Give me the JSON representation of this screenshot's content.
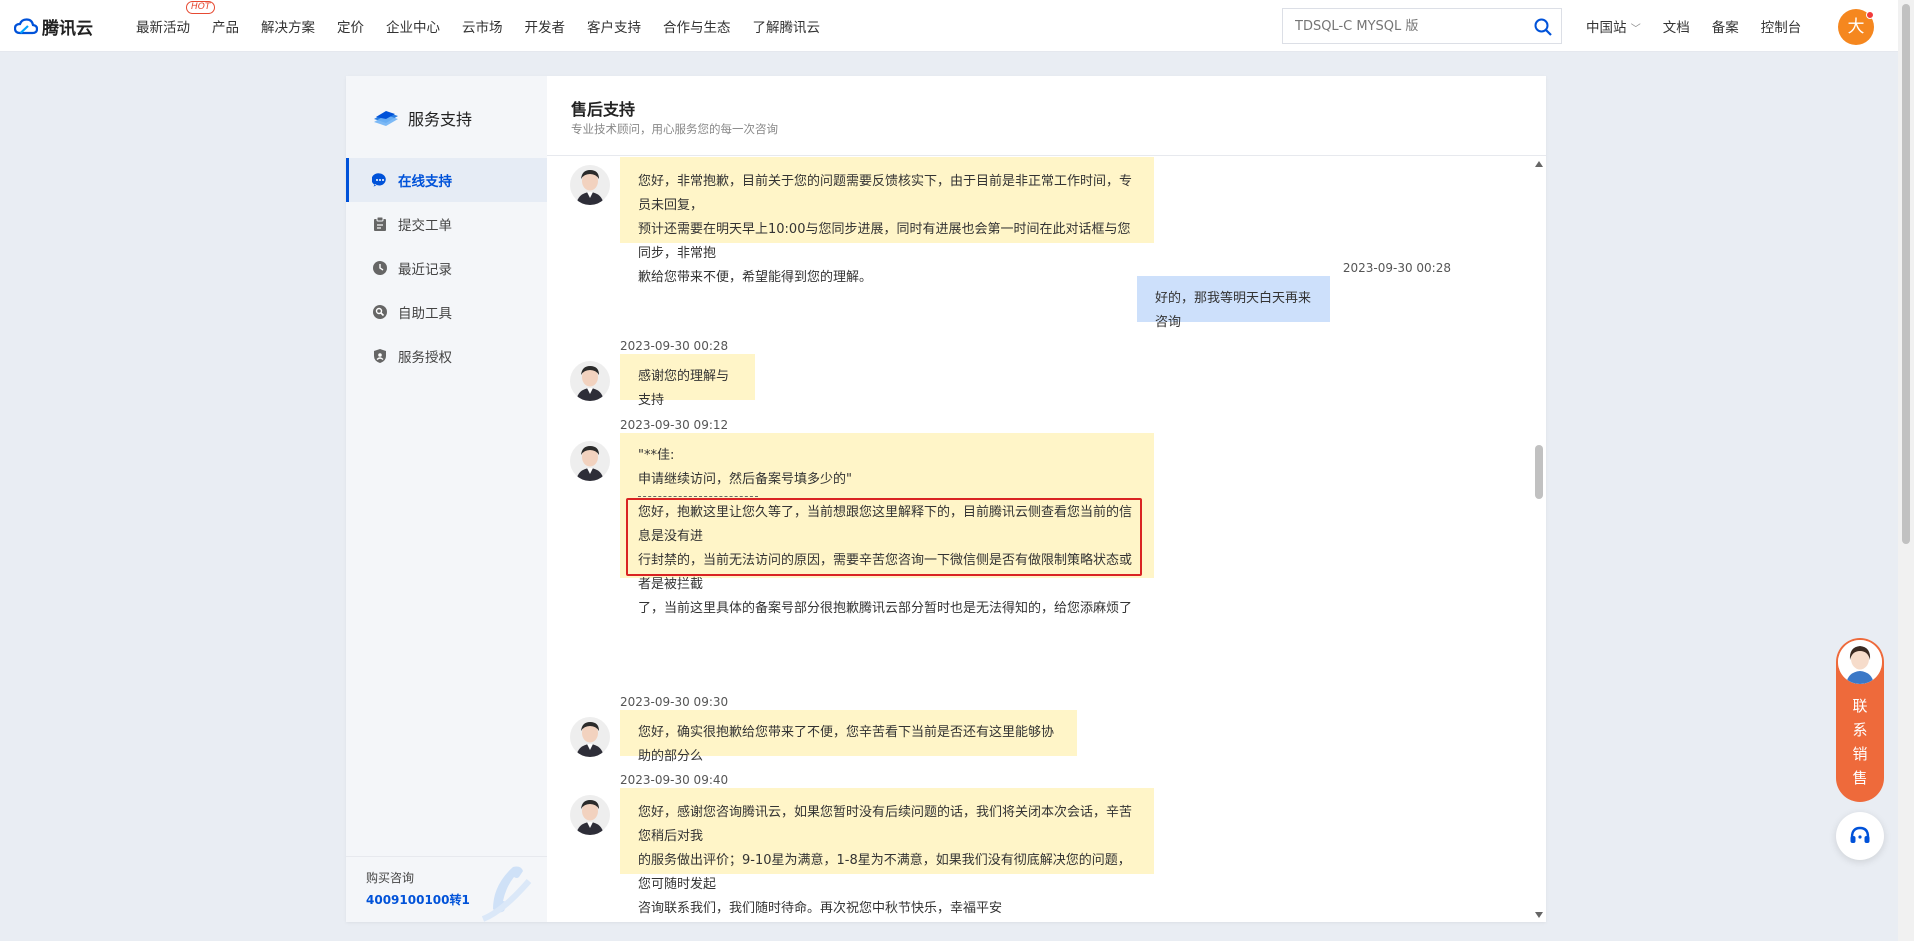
{
  "brand": {
    "name": "腾讯云"
  },
  "nav": {
    "items": [
      "最新活动",
      "产品",
      "解决方案",
      "定价",
      "企业中心",
      "云市场",
      "开发者",
      "客户支持",
      "合作与生态",
      "了解腾讯云"
    ],
    "hot_badge": "HOT"
  },
  "search": {
    "placeholder": "TDSQL-C MYSQL 版"
  },
  "right_nav": {
    "region": "中国站",
    "docs": "文档",
    "beian": "备案",
    "console": "控制台"
  },
  "user": {
    "avatar_text": "大"
  },
  "sidebar": {
    "title": "服务支持",
    "items": [
      {
        "label": "在线支持",
        "icon": "chat-icon",
        "active": true
      },
      {
        "label": "提交工单",
        "icon": "ticket-icon",
        "active": false
      },
      {
        "label": "最近记录",
        "icon": "clock-icon",
        "active": false
      },
      {
        "label": "自助工具",
        "icon": "tool-icon",
        "active": false
      },
      {
        "label": "服务授权",
        "icon": "shield-icon",
        "active": false
      }
    ],
    "footer": {
      "label": "购买咨询",
      "phone": "4009100100转1"
    }
  },
  "chat": {
    "title": "售后支持",
    "subtitle": "专业技术顾问，用心服务您的每一次咨询",
    "messages": [
      {
        "from": "agent",
        "time": "",
        "lines": [
          "您好，非常抱歉，目前关于您的问题需要反馈核实下，由于目前是非正常工作时间，专员未回复，",
          "预计还需要在明天早上10:00与您同步进展，同时有进展也会第一时间在此对话框与您同步，非常抱",
          "歉给您带来不便，希望能得到您的理解。"
        ]
      },
      {
        "from": "user",
        "time": "2023-09-30 00:28",
        "lines": [
          "好的，那我等明天白天再来咨询"
        ]
      },
      {
        "from": "agent",
        "time": "2023-09-30 00:28",
        "lines": [
          "感谢您的理解与支持"
        ]
      },
      {
        "from": "agent",
        "time": "2023-09-30 09:12",
        "quote": [
          "\"**佳:",
          "申请继续访问，然后备案号填多少的\""
        ],
        "lines": [
          "您好，抱歉这里让您久等了，当前想跟您这里解释下的，目前腾讯云侧查看您当前的信息是没有进",
          "行封禁的，当前无法访问的原因，需要辛苦您咨询一下微信侧是否有做限制策略状态或者是被拦截",
          "了，当前这里具体的备案号部分很抱歉腾讯云部分暂时也是无法得知的，给您添麻烦了"
        ]
      },
      {
        "from": "agent",
        "time": "2023-09-30 09:30",
        "lines": [
          "您好，确实很抱歉给您带来了不便，您辛苦看下当前是否还有这里能够协助的部分么"
        ]
      },
      {
        "from": "agent",
        "time": "2023-09-30 09:40",
        "lines": [
          "您好，感谢您咨询腾讯云，如果您暂时没有后续问题的话，我们将关闭本次会话，辛苦您稍后对我",
          "的服务做出评价；9-10星为满意，1-8星为不满意，如果我们没有彻底解决您的问题，您可随时发起",
          "咨询联系我们，我们随时待命。再次祝您中秋节快乐，幸福平安"
        ]
      }
    ]
  },
  "float": {
    "sales_label": [
      "联",
      "系",
      "销",
      "售"
    ]
  },
  "colors": {
    "accent": "#0052d9",
    "agent_bubble": "#fff5c8",
    "user_bubble": "#cde0fb",
    "highlight": "#d92323",
    "sales": "#ee6a3b"
  }
}
